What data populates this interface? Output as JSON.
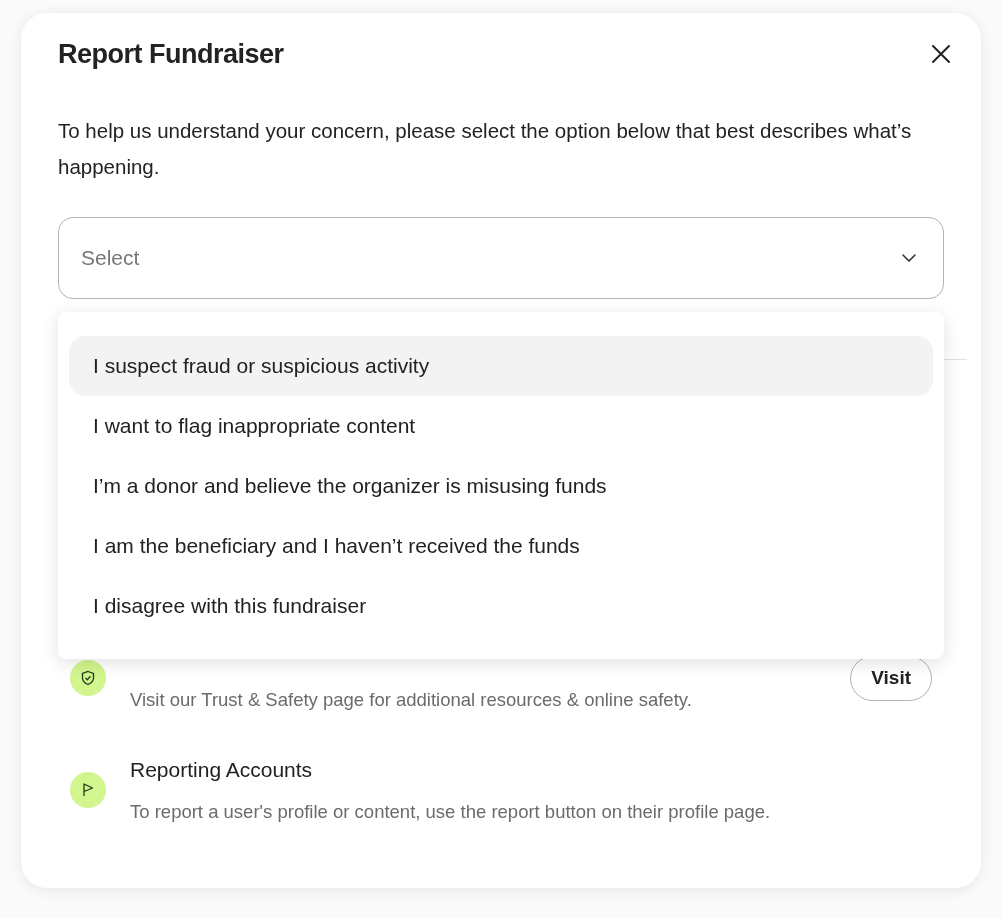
{
  "dialog": {
    "title": "Report Fundraiser",
    "intro": "To help us understand your concern, please select the option below that best describes what’s happening."
  },
  "select": {
    "placeholder": "Select",
    "expanded": true,
    "options": [
      {
        "label": "I suspect fraud or suspicious activity",
        "highlighted": true
      },
      {
        "label": "I want to flag inappropriate content",
        "highlighted": false
      },
      {
        "label": "I’m a donor and believe the organizer is misusing funds",
        "highlighted": false
      },
      {
        "label": "I am the beneficiary and I haven’t received the funds",
        "highlighted": false
      },
      {
        "label": "I disagree with this fundraiser",
        "highlighted": false
      }
    ]
  },
  "resources": [
    {
      "kind": "shield",
      "description": "Visit our Trust & Safety page for additional resources & online safety.",
      "button": "Visit"
    },
    {
      "kind": "flag",
      "title": "Reporting Accounts",
      "description": "To report a user's profile or content, use the report button on their profile page."
    }
  ]
}
